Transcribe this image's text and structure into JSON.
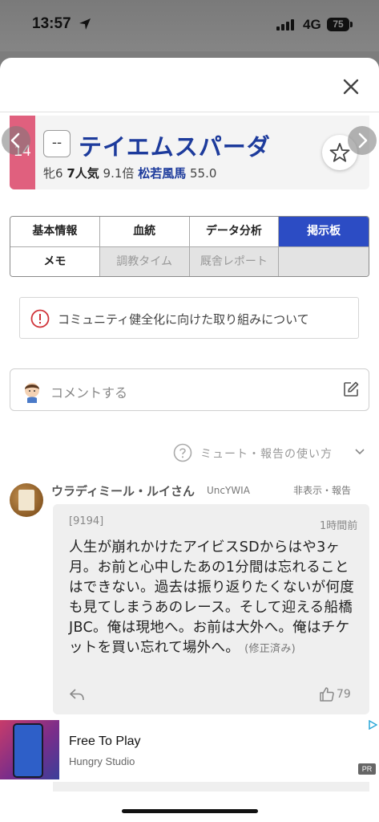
{
  "status_bar": {
    "time": "13:57",
    "network": "4G",
    "battery": "75"
  },
  "horse": {
    "gate_number": "14",
    "gate_color": "#e0607e",
    "mark": "--",
    "name": "テイエムスパーダ",
    "sex_age": "牝6",
    "popularity": "7人気",
    "odds": "9.1倍",
    "jockey": "松若風馬",
    "weight": "55.0"
  },
  "tabs": [
    {
      "label": "基本情報",
      "state": "normal"
    },
    {
      "label": "血統",
      "state": "normal"
    },
    {
      "label": "データ分析",
      "state": "normal"
    },
    {
      "label": "掲示板",
      "state": "active"
    },
    {
      "label": "メモ",
      "state": "normal"
    },
    {
      "label": "調教タイム",
      "state": "disabled"
    },
    {
      "label": "厩舎レポート",
      "state": "disabled"
    },
    {
      "label": "",
      "state": "disabled"
    }
  ],
  "notice": {
    "text": "コミュニティ健全化に向けた取り組みについて"
  },
  "comment_input": {
    "placeholder": "コメントする"
  },
  "mute_help": {
    "label": "ミュート・報告の使い方"
  },
  "post": {
    "username": "ウラディミール・ルイさん",
    "user_id": "UncYWIA",
    "actions": "非表示・報告",
    "post_number": "[9194]",
    "time_ago": "1時間前",
    "body": "人生が崩れかけたアイビスSDからはや3ヶ月。お前と心中したあの1分間は忘れることはできない。過去は振り返りたくないが何度も見てしまうあのレース。そして迎える船橋JBC。俺は現地へ。お前は大外へ。俺はチケットを買い忘れて場外へ。",
    "edited_label": "(修正済み)",
    "like_count": "79"
  },
  "ad": {
    "title": "Free To Play",
    "subtitle": "Hungry Studio",
    "badge": "PR"
  },
  "colors": {
    "accent_blue": "#2c4cc4",
    "horse_name_blue": "#1d3b9c"
  }
}
